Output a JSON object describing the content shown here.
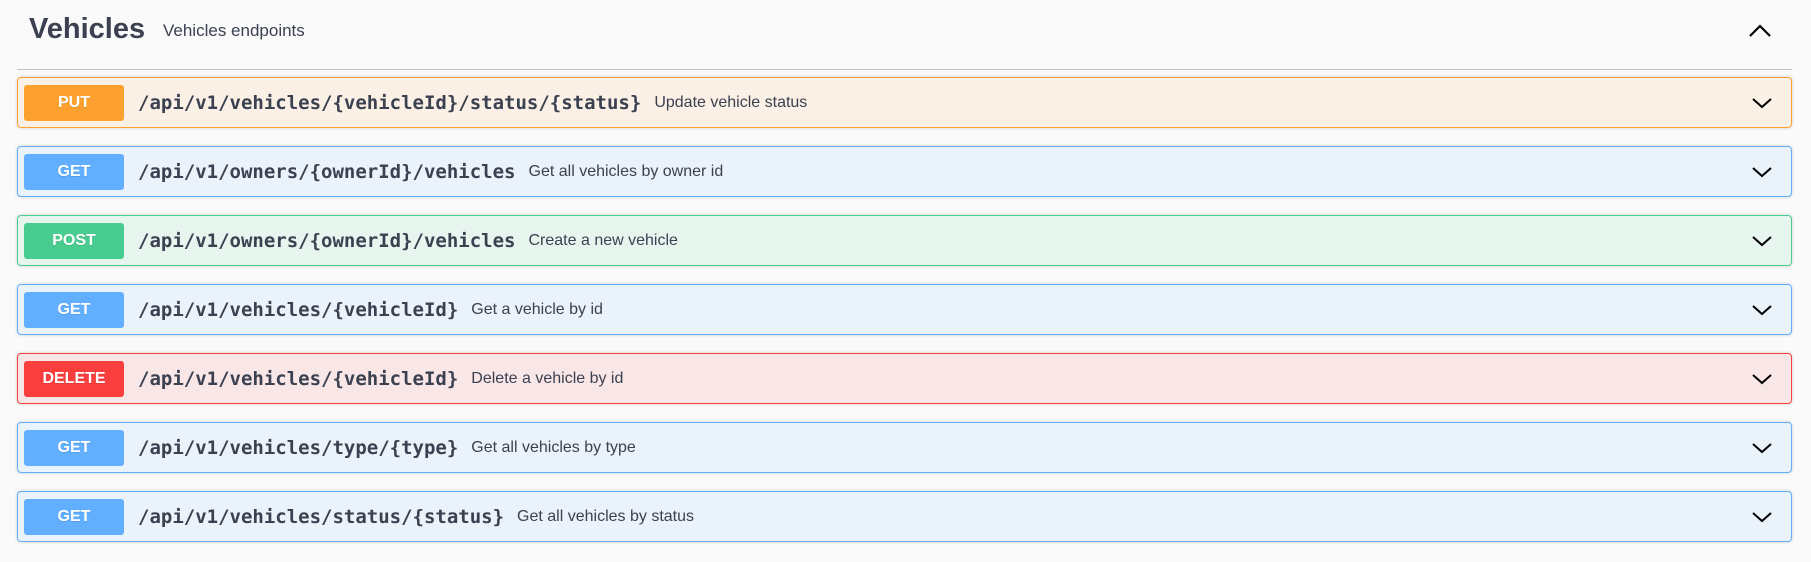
{
  "section": {
    "title": "Vehicles",
    "description": "Vehicles endpoints",
    "collapse_icon": "chevron-up-icon"
  },
  "colors": {
    "put": "#fca130",
    "get": "#61affe",
    "post": "#49cc90",
    "delete": "#f93e3e",
    "text": "#3b4151"
  },
  "operations": [
    {
      "method": "PUT",
      "path": "/api/v1/vehicles/{vehicleId}/status/{status}",
      "summary": "Update vehicle status",
      "icon": "chevron-down-icon"
    },
    {
      "method": "GET",
      "path": "/api/v1/owners/{ownerId}/vehicles",
      "summary": "Get all vehicles by owner id",
      "icon": "chevron-down-icon"
    },
    {
      "method": "POST",
      "path": "/api/v1/owners/{ownerId}/vehicles",
      "summary": "Create a new vehicle",
      "icon": "chevron-down-icon"
    },
    {
      "method": "GET",
      "path": "/api/v1/vehicles/{vehicleId}",
      "summary": "Get a vehicle by id",
      "icon": "chevron-down-icon"
    },
    {
      "method": "DELETE",
      "path": "/api/v1/vehicles/{vehicleId}",
      "summary": "Delete a vehicle by id",
      "icon": "chevron-down-icon"
    },
    {
      "method": "GET",
      "path": "/api/v1/vehicles/type/{type}",
      "summary": "Get all vehicles by type",
      "icon": "chevron-down-icon"
    },
    {
      "method": "GET",
      "path": "/api/v1/vehicles/status/{status}",
      "summary": "Get all vehicles by status",
      "icon": "chevron-down-icon"
    }
  ]
}
